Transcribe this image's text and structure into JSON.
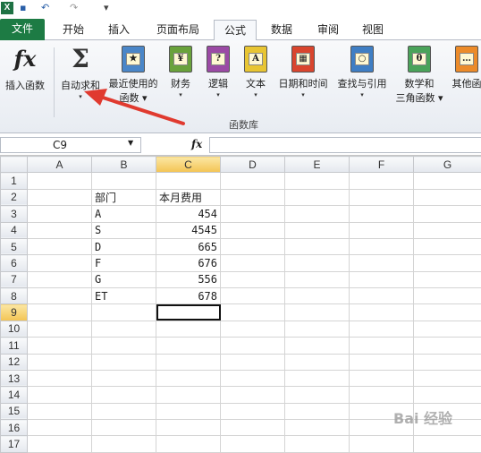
{
  "qat": {
    "app_icon": "X",
    "undo": "↶",
    "redo": "↷"
  },
  "tabs": [
    "文件",
    "开始",
    "插入",
    "页面布局",
    "公式",
    "数据",
    "审阅",
    "视图"
  ],
  "ribbon": {
    "insert_function": "插入函数",
    "autosum": [
      "自动求和",
      "▾"
    ],
    "recent": [
      "最近使用的",
      "函数 ▾"
    ],
    "finance": [
      "财务",
      "▾"
    ],
    "logic": [
      "逻辑",
      "▾"
    ],
    "text": [
      "文本",
      "▾"
    ],
    "datetime": [
      "日期和时间",
      "▾"
    ],
    "lookup": [
      "查找与引用",
      "▾"
    ],
    "math": [
      "数学和",
      "三角函数 ▾"
    ],
    "other": [
      "其他函"
    ],
    "group_label": "函数库"
  },
  "formula_bar": {
    "name_box": "C9",
    "fx": "fx",
    "content": ""
  },
  "sheet": {
    "columns": [
      "A",
      "B",
      "C",
      "D",
      "E",
      "F",
      "G"
    ],
    "rows": [
      "1",
      "2",
      "3",
      "4",
      "5",
      "6",
      "7",
      "8",
      "9",
      "10",
      "11",
      "12",
      "13",
      "14",
      "15",
      "16",
      "17"
    ],
    "header": {
      "dept": "部门",
      "cost": "本月费用"
    },
    "data": [
      {
        "dept": "A",
        "cost": "454"
      },
      {
        "dept": "S",
        "cost": "4545"
      },
      {
        "dept": "D",
        "cost": "665"
      },
      {
        "dept": "F",
        "cost": "676"
      },
      {
        "dept": "G",
        "cost": "556"
      },
      {
        "dept": "ET",
        "cost": "678"
      }
    ]
  },
  "watermark": "Bai 经验",
  "colors": {
    "file_tab": "#1d7b44",
    "selected_header": "#f3c453",
    "arrow": "#e03a2f"
  }
}
